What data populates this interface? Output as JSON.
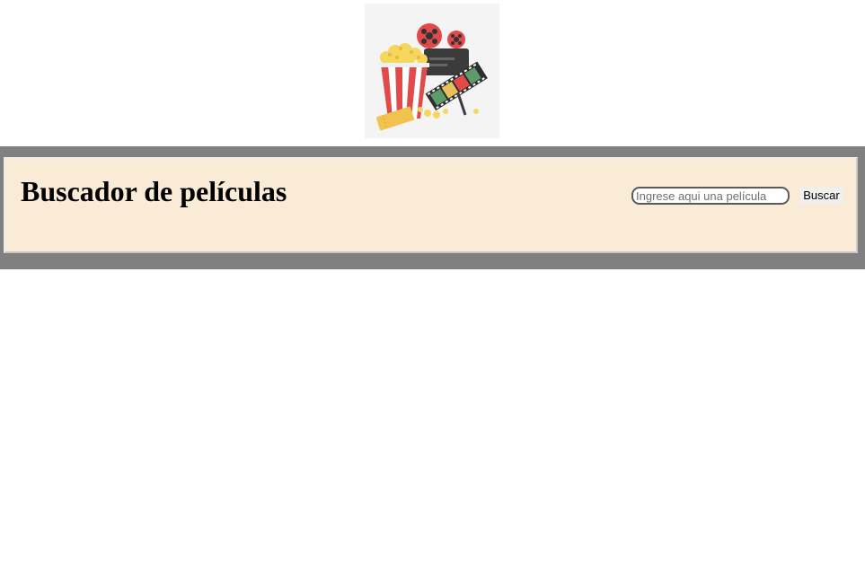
{
  "logo": {
    "icon": "cinema-popcorn-filmreel-icon"
  },
  "header": {
    "title": "Buscador de películas",
    "search": {
      "placeholder": "Ingrese aqui una película",
      "value": "",
      "button_label": "Buscar"
    }
  },
  "colors": {
    "header_frame": "#808080",
    "header_panel": "#faebd7"
  }
}
